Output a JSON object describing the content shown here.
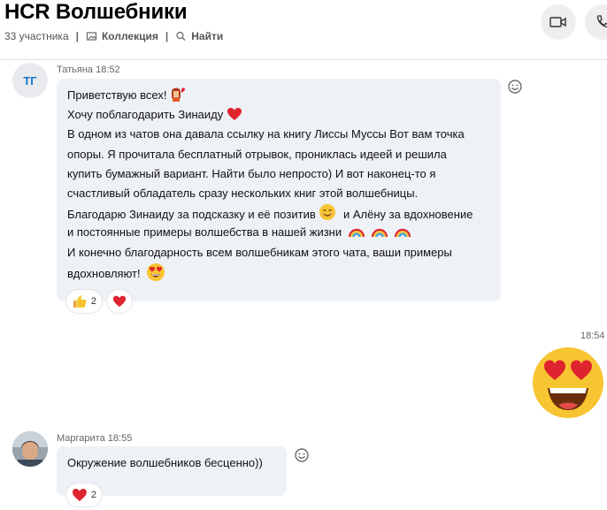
{
  "header": {
    "title": "HCR Волшебники",
    "participants": "33 участника",
    "collection": "Коллекция",
    "search": "Найти"
  },
  "messages": [
    {
      "author": "Татьяна",
      "time": "18:52",
      "avatar_initials": "ТГ",
      "lines": [
        "Приветствую всех!",
        "Хочу поблагодарить Зинаиду",
        "В одном из чатов она давала ссылку на книгу Лиссы Муссы Вот вам точка",
        "опоры. Я прочитала бесплатный отрывок, прониклась идеей и решила",
        "купить бумажный вариант. Найти было непросто) И вот наконец-то я",
        "счастливый обладатель сразу нескольких книг этой волшебницы.",
        "Благодарю Зинаиду за подсказку и её позитив",
        "и Алёну за вдохновение",
        "и постоянные примеры волшебства в нашей жизни",
        "И конечно благодарность всем волшебникам этого чата, ваши примеры",
        "вдохновляют!"
      ],
      "reactions": [
        {
          "icon": "thumbs-up-icon",
          "count": "2"
        },
        {
          "icon": "heart-icon",
          "count": ""
        }
      ]
    },
    {
      "author": "",
      "time": "18:54",
      "content_icon": "heart-eyes-emoji"
    },
    {
      "author": "Маргарита",
      "time": "18:55",
      "lines": [
        "Окружение волшебников бесценно))"
      ],
      "reactions": [
        {
          "icon": "heart-icon",
          "count": "2"
        }
      ]
    }
  ],
  "colors": {
    "bubble": "#eef1f6",
    "accent": "#1a73c9",
    "heart": "#e0242f"
  }
}
